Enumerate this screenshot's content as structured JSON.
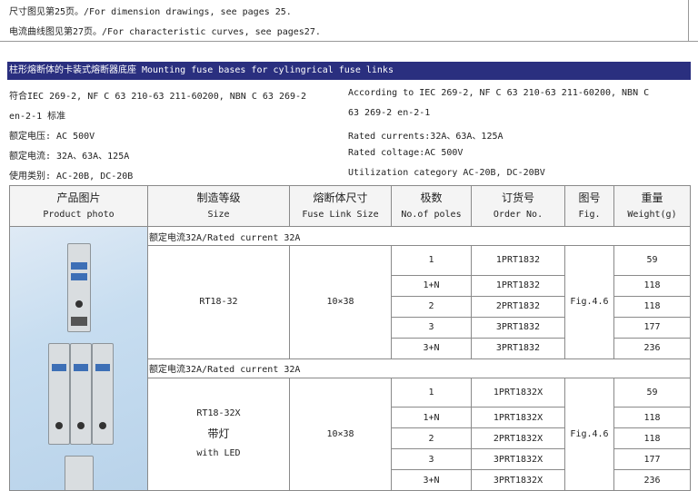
{
  "notes": [
    "尺寸图见第25页。/For dimension drawings, see pages 25.",
    "电流曲线图见第27页。/For characteristic curves, see pages27."
  ],
  "banner": "柱形熔断体的卡装式熔断器底座 Mounting fuse bases for cylingrical fuse links",
  "specs_left": [
    "符合IEC 269-2, NF C 63 210-63 211-60200, NBN C 63 269-2",
    "en-2-1 标准",
    "额定电压: AC 500V",
    "额定电流: 32A、63A、125A",
    "使用类别: AC-20B, DC-20B"
  ],
  "specs_right": [
    "According to IEC 269-2, NF C 63 210-63 211-60200, NBN C",
    "63 269-2 en-2-1",
    "Rated currents:32A、63A、125A",
    "Rated coltage:AC 500V",
    "Utilization category AC-20B, DC-20BV"
  ],
  "table": {
    "headers": [
      {
        "cn": "产品图片",
        "en": "Product photo"
      },
      {
        "cn": "制造等级",
        "en": "Size"
      },
      {
        "cn": "熔断体尺寸",
        "en": "Fuse Link Size"
      },
      {
        "cn": "极数",
        "en": "No.of poles"
      },
      {
        "cn": "订货号",
        "en": "Order No."
      },
      {
        "cn": "图号",
        "en": "Fig."
      },
      {
        "cn": "重量",
        "en": "Weight(g)"
      }
    ],
    "sections": [
      {
        "title": "额定电流32A/Rated current 32A",
        "size_lines": [
          "RT18-32"
        ],
        "fuse_size": "10×38",
        "fig": "Fig.4.6",
        "rows": [
          {
            "poles": "1",
            "order": "1PRT1832",
            "weight": "59"
          },
          {
            "poles": "1+N",
            "order": "1PRT1832",
            "weight": "118"
          },
          {
            "poles": "2",
            "order": "2PRT1832",
            "weight": "118"
          },
          {
            "poles": "3",
            "order": "3PRT1832",
            "weight": "177"
          },
          {
            "poles": "3+N",
            "order": "3PRT1832",
            "weight": "236"
          }
        ]
      },
      {
        "title": "额定电流32A/Rated current 32A",
        "size_lines": [
          "RT18-32X",
          "带灯",
          "with LED"
        ],
        "fuse_size": "10×38",
        "fig": "Fig.4.6",
        "rows": [
          {
            "poles": "1",
            "order": "1PRT1832X",
            "weight": "59"
          },
          {
            "poles": "1+N",
            "order": "1PRT1832X",
            "weight": "118"
          },
          {
            "poles": "2",
            "order": "2PRT1832X",
            "weight": "118"
          },
          {
            "poles": "3",
            "order": "3PRT1832X",
            "weight": "177"
          },
          {
            "poles": "3+N",
            "order": "3PRT1832X",
            "weight": "236"
          }
        ]
      }
    ]
  }
}
